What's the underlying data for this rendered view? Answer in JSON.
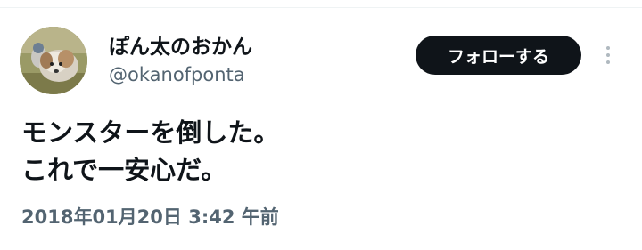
{
  "author": {
    "display_name": "ぽん太のおかん",
    "handle": "@okanofponta"
  },
  "actions": {
    "follow_label": "フォローする",
    "more_icon": "more-vertical-icon"
  },
  "tweet": {
    "line1": "モンスターを倒した。",
    "line2": "これで一安心だ。"
  },
  "timestamp": "2018年01月20日 3:42 午前",
  "colors": {
    "text_primary": "#0f1419",
    "text_secondary": "#536471",
    "follow_bg": "#0f1419",
    "follow_text": "#ffffff",
    "border": "#eff3f4"
  }
}
